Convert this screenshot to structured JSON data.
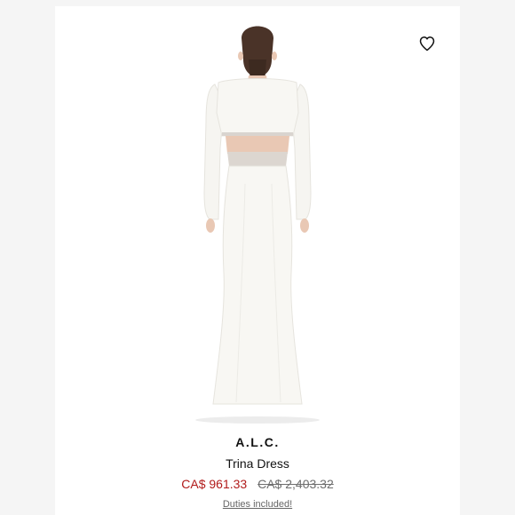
{
  "product": {
    "brand": "A.L.C.",
    "name": "Trina Dress",
    "sale_price": "CA$ 961.33",
    "original_price": "CA$ 2,403.32",
    "duties_link": "Duties included!",
    "sale_color": "#b11b1b"
  },
  "icons": {
    "wishlist": "heart-outline-icon"
  }
}
